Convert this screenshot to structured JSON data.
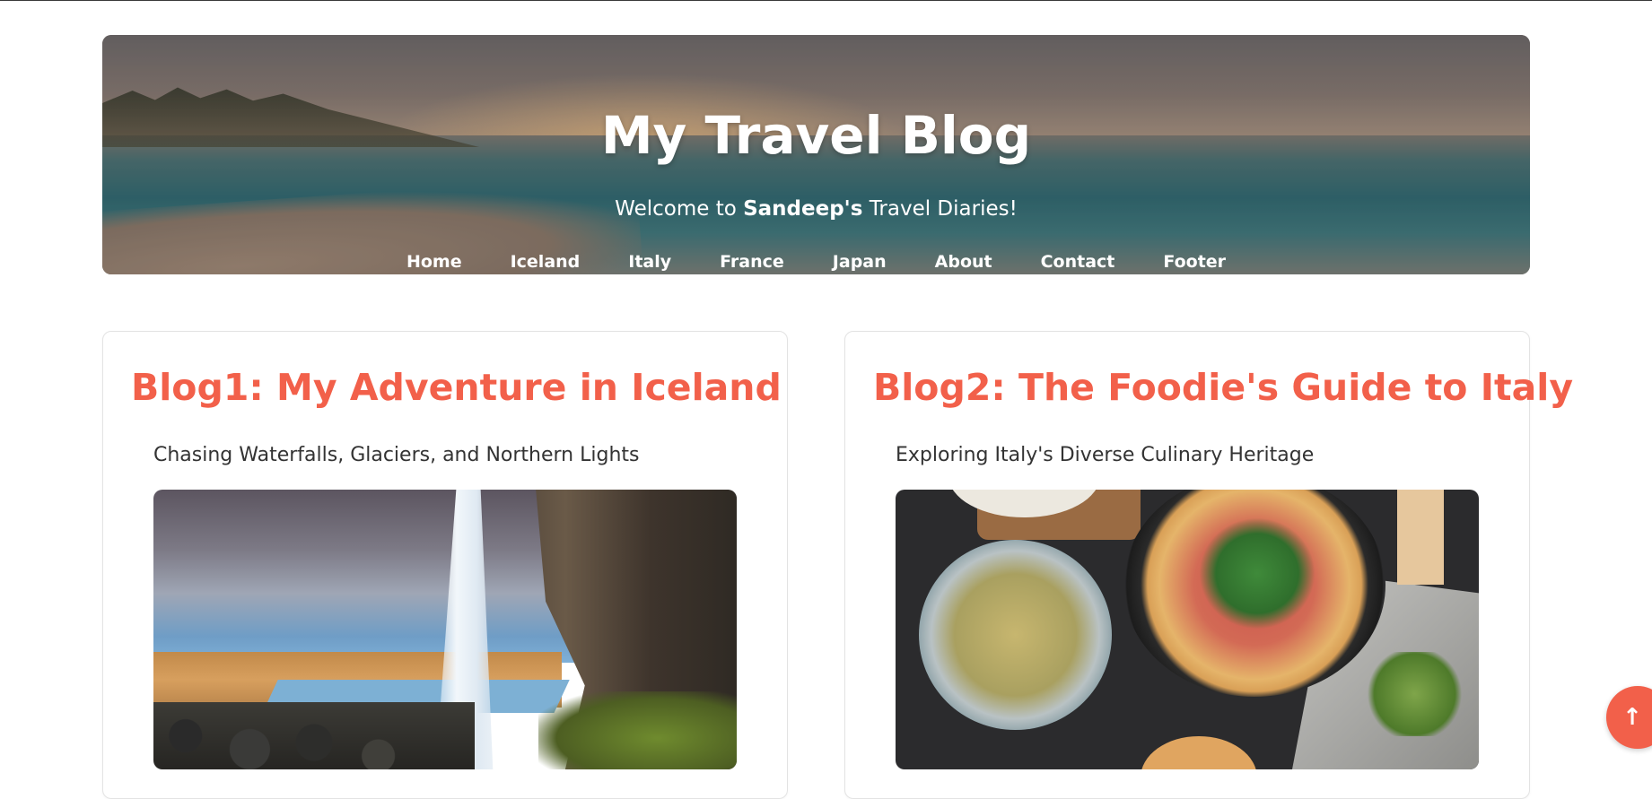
{
  "header": {
    "title": "My Travel Blog",
    "subtitle_prefix": "Welcome to ",
    "subtitle_name": "Sandeep's",
    "subtitle_suffix": " Travel Diaries!",
    "background_image": "beach-sunset-image",
    "nav": [
      {
        "label": "Home"
      },
      {
        "label": "Iceland"
      },
      {
        "label": "Italy"
      },
      {
        "label": "France"
      },
      {
        "label": "Japan"
      },
      {
        "label": "About"
      },
      {
        "label": "Contact"
      },
      {
        "label": "Footer"
      }
    ]
  },
  "posts": [
    {
      "title": "Blog1: My Adventure in Iceland",
      "tagline": "Chasing Waterfalls, Glaciers, and Northern Lights",
      "image": "iceland-waterfall-image"
    },
    {
      "title": "Blog2: The Foodie's Guide to Italy",
      "tagline": "Exploring Italy's Diverse Culinary Heritage",
      "image": "italian-food-image"
    }
  ],
  "scroll_top": {
    "icon": "arrow-up-icon",
    "glyph": "↑"
  },
  "colors": {
    "accent": "#f2604a",
    "text": "#333333",
    "card_border": "#e3e3e3"
  }
}
